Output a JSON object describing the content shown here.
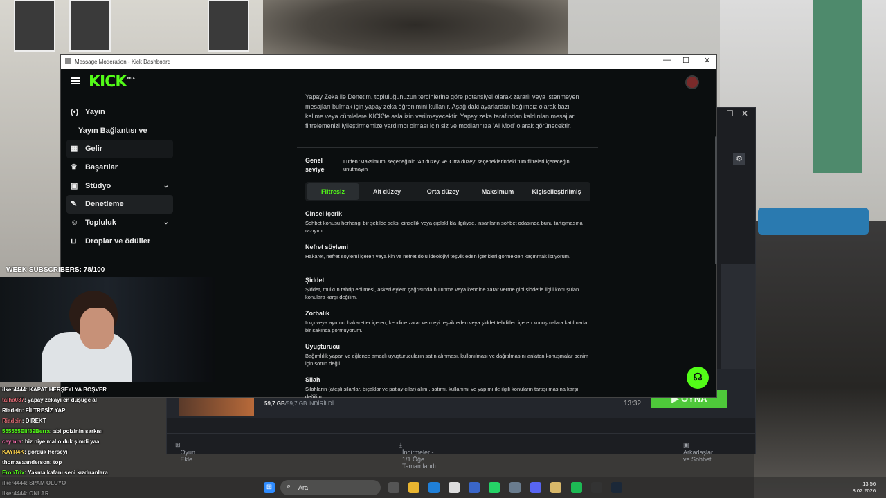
{
  "window": {
    "title": "Message Moderation - Kick Dashboard",
    "minimize": "—",
    "maximize": "☐",
    "close": "✕"
  },
  "brand": {
    "logo": "KICK",
    "badge": "BETA",
    "accent": "#53fc18"
  },
  "nav": [
    {
      "label": "Yayın",
      "icon": "broadcast-icon"
    },
    {
      "label": "Yayın Bağlantısı ve Anahtarı"
    },
    {
      "label": "Gelir",
      "icon": "revenue-icon"
    },
    {
      "label": "Başarılar",
      "icon": "trophy-icon"
    },
    {
      "label": "Stüdyo",
      "icon": "studio-icon",
      "expandable": true
    },
    {
      "label": "Denetleme",
      "icon": "wrench-icon",
      "active": true
    },
    {
      "label": "Topluluk",
      "icon": "community-icon",
      "expandable": true
    },
    {
      "label": "Droplar ve ödüller",
      "icon": "drops-icon"
    }
  ],
  "intro": "Yapay Zeka ile Denetim, topluluğunuzun tercihlerine göre potansiyel olarak zararlı veya istenmeyen mesajları bulmak için yapay zeka öğrenimini kullanır. Aşağıdaki ayarlardan bağımsız olarak bazı kelime veya cümlelere KICK'te asla izin verilmeyecektir. Yapay zeka tarafından kaldırılan mesajlar, filtrelemenizi iyileştirmemize yardımcı olması için siz ve modlarınıza 'AI Mod' olarak görünecektir.",
  "general": {
    "label": "Genel seviye",
    "note": "Lütfen 'Maksimum' seçeneğinin 'Alt düzey' ve 'Orta düzey' seçeneklerindeki tüm filtreleri içereceğini unutmayın"
  },
  "tabs": [
    {
      "label": "Filtresiz",
      "selected": true
    },
    {
      "label": "Alt düzey"
    },
    {
      "label": "Orta düzey"
    },
    {
      "label": "Maksimum"
    },
    {
      "label": "Kişiselleştirilmiş"
    }
  ],
  "categories": [
    {
      "title": "Cinsel içerik",
      "desc": "Sohbet konusu herhangi bir şekilde seks, cinsellik veya çıplaklıkla ilgiliyse, insanların sohbet odasında bunu tartışmasına razıyım."
    },
    {
      "title": "Nefret söylemi",
      "desc": "Hakaret, nefret söylemi içeren veya kin ve nefret dolu ideolojiyi teşvik eden içerikleri görmekten kaçınmak istiyorum."
    },
    {
      "title": "Şiddet",
      "desc": "Şiddet, mülkün tahrip edilmesi, askeri eylem çağrısında bulunma veya kendine zarar verme gibi şiddetle ilgili konuşulan konulara karşı değilim."
    },
    {
      "title": "Zorbalık",
      "desc": "Irkçı veya ayrımcı hakaretler içeren, kendine zarar vermeyi teşvik eden veya şiddet tehditleri içeren konuşmalara katılmada bir sakınca görmüyorum."
    },
    {
      "title": "Uyuşturucu",
      "desc": "Bağımlılık yapan ve eğlence amaçlı uyuşturucuların satın alınması, kullanılması ve dağıtılmasını anlatan konuşmalar benim için sorun değil."
    },
    {
      "title": "Silah",
      "desc": "Silahların (ateşli silahlar, bıçaklar ve patlayıcılar) alımı, satımı, kullanımı ve yapımı ile ilgili konuların tartışılmasına karşı değilim."
    }
  ],
  "steam": {
    "download_size": "59,7 GB",
    "download_total": "/59,7 GB İNDİRİLDİ",
    "time": "13:32",
    "play": "▶ OYNA",
    "add_game": "Oyun Ekle",
    "downloads": "İndirmeler - 1/1 Öğe Tamamlandı",
    "friends": "Arkadaşlar ve Sohbet"
  },
  "stream": {
    "subs": "WEEK SUBSCRIBERS: 78/100"
  },
  "chat": [
    {
      "user": "ilker4444",
      "msg": ": KAPAT HERŞEYİ YA BOŞVER",
      "color": "#ffffff"
    },
    {
      "user": "talha037",
      "msg": ": yapay zekayı en düşüğe al",
      "color": "#e06c75"
    },
    {
      "user": "Riadein",
      "msg": ": FİLTRESİZ YAP",
      "color": "#ffffff"
    },
    {
      "user": "Riadein",
      "msg": ": DİREKT",
      "color": "#e06c75"
    },
    {
      "user": "555555Elif89Berra",
      "msg": ": abi poizinin şarkısı",
      "color": "#53fc18"
    },
    {
      "user": "ceymra",
      "msg": ": biz niye mal olduk şimdi yaa",
      "color": "#ff6fb5"
    },
    {
      "user": "KAYR4K",
      "msg": ": gorduk herseyi",
      "color": "#ffd54f"
    },
    {
      "user": "thomasaanderson",
      "msg": ": top",
      "color": "#ffffff"
    },
    {
      "user": "EronTrix",
      "msg": ": Yakma kafanı seni kızdıranlara",
      "color": "#53fc18"
    },
    {
      "user": "ilker4444",
      "msg": ": SPAM OLUYO",
      "color": "#ffffff"
    },
    {
      "user": "ilker4444",
      "msg": ": ONLAR",
      "color": "#ffffff"
    }
  ],
  "taskbar": {
    "search_label": "Ara",
    "time": "13:56",
    "date": "8.02.2026"
  }
}
